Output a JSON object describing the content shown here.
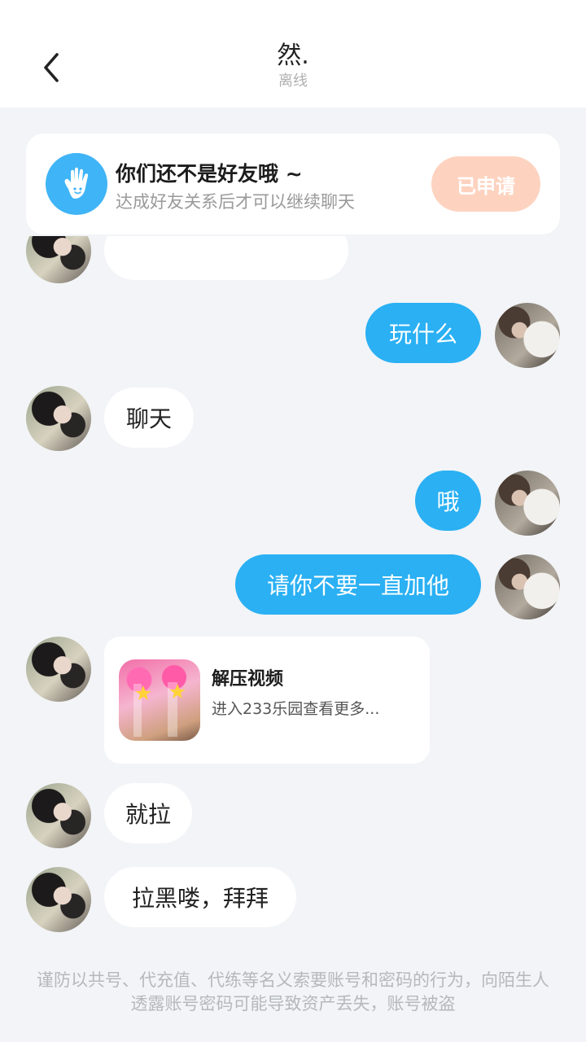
{
  "header": {
    "title": "然.",
    "status": "离线"
  },
  "notice": {
    "title": "你们还不是好友哦 ~",
    "subtitle": "达成好友关系后才可以继续聊天",
    "button": "已申请"
  },
  "messages": [
    {
      "from": "me",
      "text": "玩什么"
    },
    {
      "from": "her",
      "text": "聊天"
    },
    {
      "from": "me",
      "text": "哦"
    },
    {
      "from": "me",
      "text": "请你不要一直加他"
    },
    {
      "from": "her",
      "type": "video",
      "title": "解压视频",
      "desc": "进入233乐园查看更多..."
    },
    {
      "from": "her",
      "text": "就拉"
    },
    {
      "from": "her",
      "text": "拉黑喽，拜拜"
    }
  ],
  "footer": {
    "warning": "谨防以共号、代充值、代练等名义索要账号和密码的行为，向陌生人透露账号密码可能导致资产丢失，账号被盗"
  },
  "colors": {
    "accent": "#2ab0f3",
    "applied_button": "#fdd3c0",
    "background": "#f2f4f7"
  },
  "icons": {
    "back": "chevron-left-icon",
    "notice": "hand-icon"
  }
}
